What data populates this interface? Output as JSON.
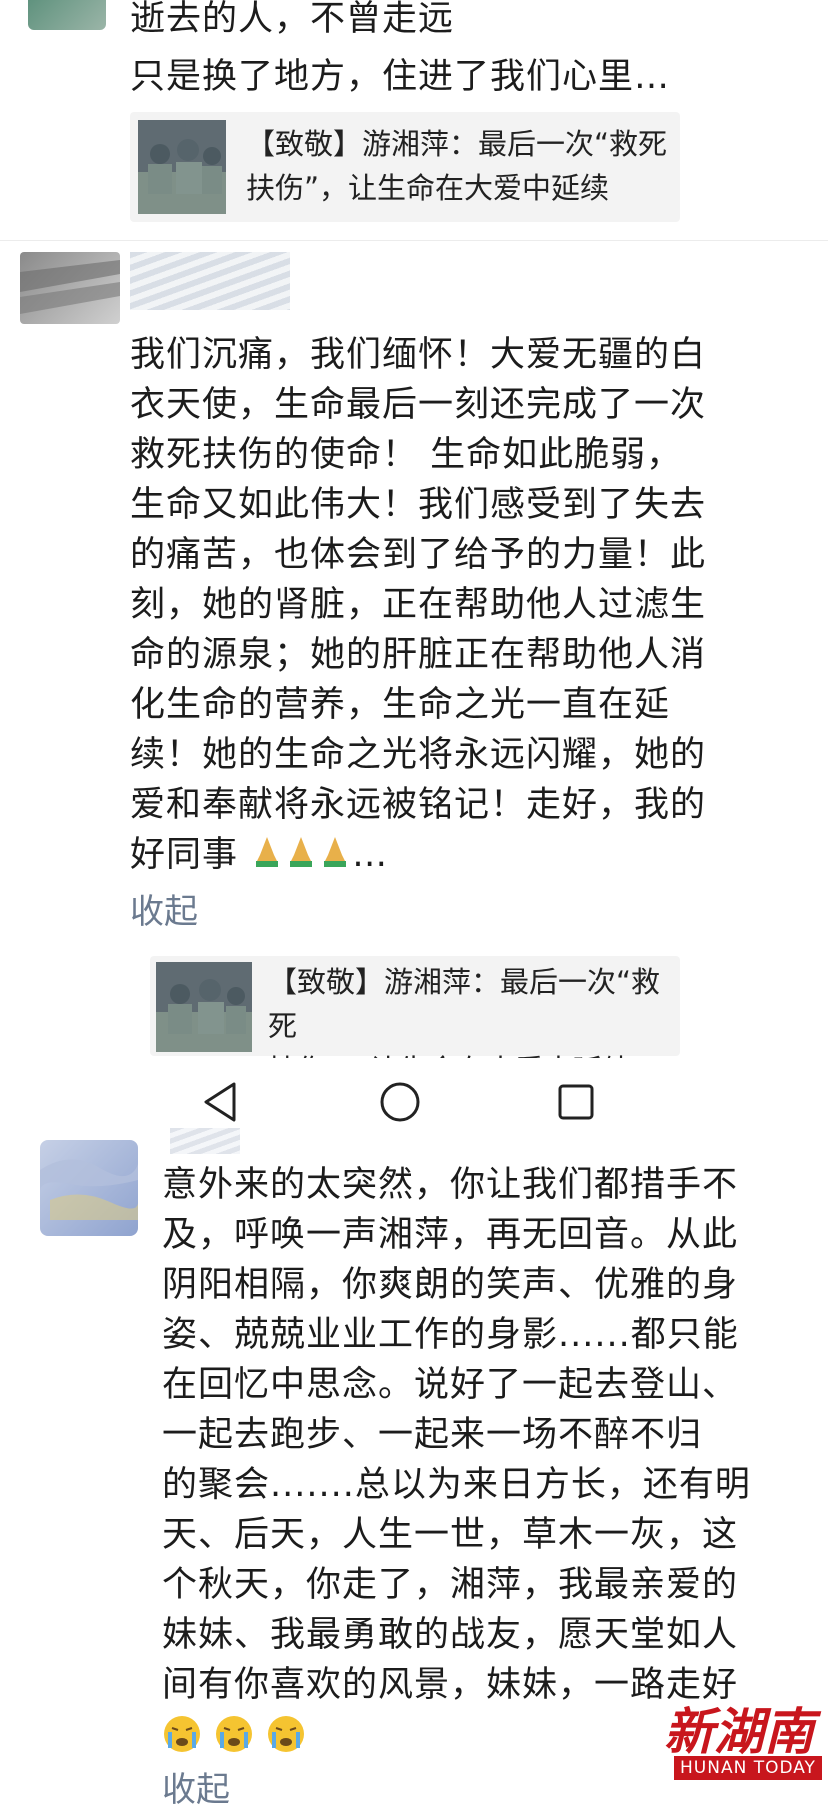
{
  "comments": [
    {
      "text_lines": [
        "逝去的人，不曾走远",
        "只是换了地方，住进了我们心里…"
      ],
      "card_lines": [
        "【致敬】游湘萍：最后一次“救死",
        "扶伤”，让生命在大爱中延续"
      ]
    },
    {
      "text_lines": [
        "我们沉痛，我们缅怀！大爱无疆的白",
        "衣天使，生命最后一刻还完成了一次",
        "救死扶伤的使命！ 生命如此脆弱，",
        "生命又如此伟大！我们感受到了失去",
        "的痛苦，也体会到了给予的力量！此",
        "刻，她的肾脏，正在帮助他人过滤生",
        "命的源泉；她的肝脏正在帮助他人消",
        "化生命的营养，生命之光一直在延",
        "续！她的生命之光将永远闪耀，她的",
        "爱和奉献将永远被铭记！走好，我的",
        "好同事"
      ],
      "last_line_suffix": "…",
      "collapse_label": "收起",
      "card_lines": [
        "【致敬】游湘萍：最后一次“救死",
        "扶伤”，让生命在大爱中延续"
      ]
    },
    {
      "text_lines": [
        "意外来的太突然，你让我们都措手不",
        "及，呼唤一声湘萍，再无回音。从此",
        "阴阳相隔，你爽朗的笑声、优雅的身",
        "姿、兢兢业业工作的身影......都只能",
        "在回忆中思念。说好了一起去登山、",
        "一起去跑步、一起来一场不醉不归",
        "的聚会.......总以为来日方长，还有明",
        "天、后天，人生一世，草木一灰，这",
        "个秋天，你走了，湘萍，我最亲爱的",
        "妹妹、我最勇敢的战友，愿天堂如人",
        "间有你喜欢的风景，妹妹，一路走好"
      ],
      "collapse_label": "收起"
    }
  ],
  "navbar": {
    "back_icon": "back-triangle-icon",
    "home_icon": "home-circle-icon",
    "recents_icon": "recents-square-icon"
  },
  "watermark": {
    "logo": "新湖南",
    "sub": "HUNAN TODAY"
  },
  "colors": {
    "link": "#6b7a8f",
    "card_bg": "#f3f3f3",
    "brand": "#c8161d"
  }
}
